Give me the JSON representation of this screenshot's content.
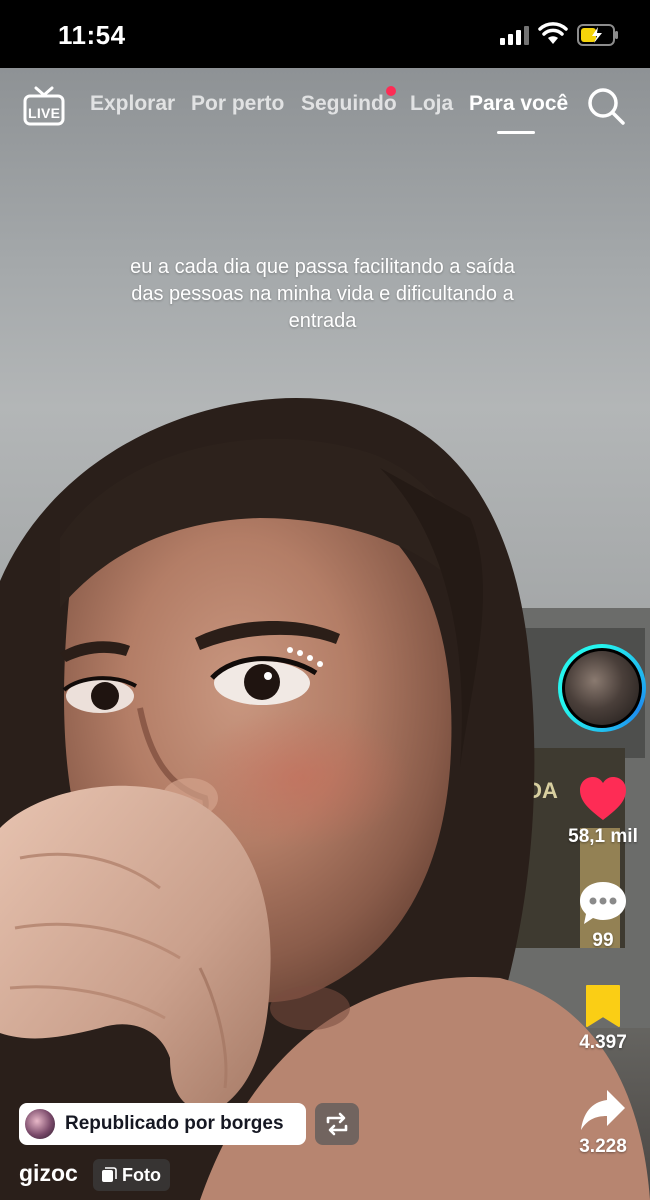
{
  "status_bar": {
    "time": "11:54"
  },
  "nav": {
    "live_label": "LIVE",
    "tabs": [
      {
        "label": "Explorar"
      },
      {
        "label": "Por perto"
      },
      {
        "label": "Seguindo"
      },
      {
        "label": "Loja"
      },
      {
        "label": "Para você"
      }
    ],
    "active_tab": "Para você"
  },
  "post": {
    "caption": "eu a cada dia que passa facilitando a saída das pessoas na minha vida e dificultando a entrada",
    "repost_text": "Republicado por borges",
    "username": "gizoc",
    "type_label": "Foto"
  },
  "actions": {
    "likes": "58,1 mil",
    "comments": "99",
    "saves": "4.397",
    "shares": "3.228"
  },
  "colors": {
    "like": "#fe2c55",
    "save": "#face15",
    "ring": "#25f4ee",
    "notification_dot": "#fe2c55"
  },
  "icons": [
    "live-icon",
    "search-icon",
    "heart-icon",
    "comment-icon",
    "bookmark-icon",
    "share-icon",
    "repost-icon",
    "photo-icon"
  ]
}
